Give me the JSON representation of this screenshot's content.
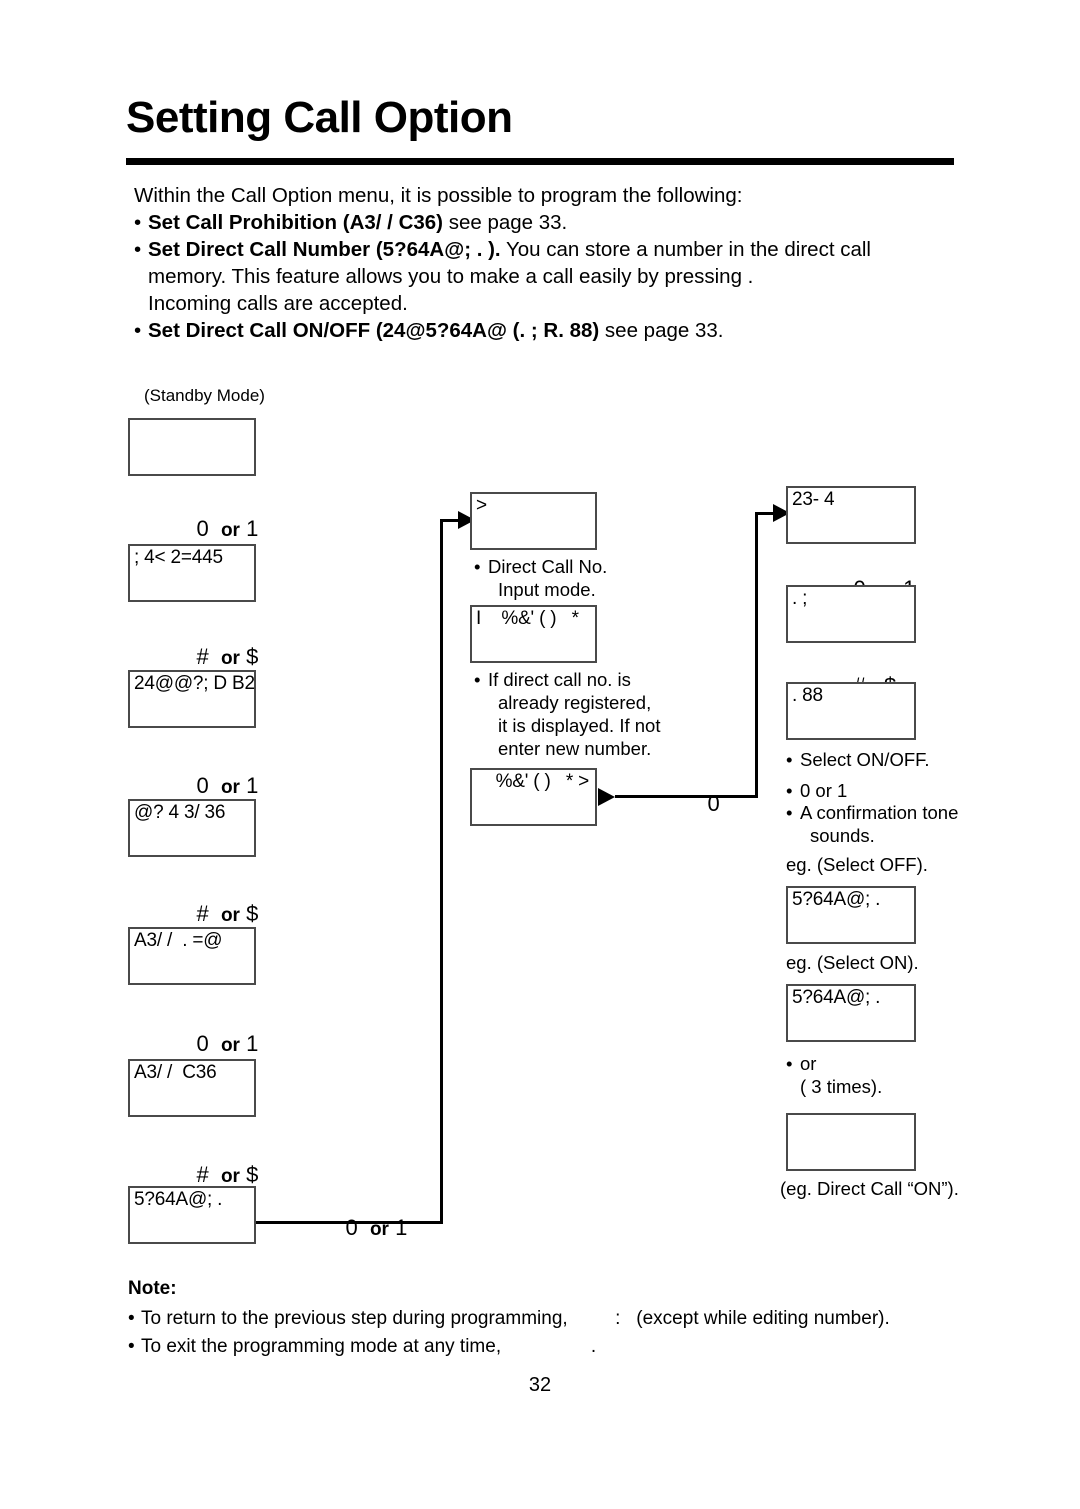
{
  "document": {
    "title": "Setting Call Option",
    "page_number": "32"
  },
  "intro": {
    "lead": "Within the Call Option menu, it is possible to program the following:",
    "bullets": [
      {
        "bold": "Set Call Prohibition (A3/ /  C36)",
        "rest": " see page 33."
      },
      {
        "bold": "Set Direct Call Number (5?64A@; . ).",
        "rest": " You can store a number in the direct call",
        "line2": "memory. This feature allows you to make a call easily by pressing         .",
        "line3": "Incoming calls are accepted."
      },
      {
        "bold": "Set Direct Call ON/OFF (24@5?64A@ (. ; R. 88)",
        "rest": " see page 33."
      }
    ]
  },
  "diagram": {
    "standby_label": "(Standby Mode)",
    "left_column": {
      "screens": [
        {
          "text": ""
        },
        {
          "text": "; 4< 2=445"
        },
        {
          "text": "24@@?; D B2"
        },
        {
          "text": "@? 4 3/ 36"
        },
        {
          "text": "A3/ /  . =@"
        },
        {
          "text": "A3/ /  C36"
        },
        {
          "text": "5?64A@; ."
        }
      ],
      "key_steps": [
        {
          "first": "0",
          "or": "or",
          "second": "1"
        },
        {
          "first": "#",
          "or": "or",
          "second": "$"
        },
        {
          "first": "0",
          "or": "or",
          "second": "1"
        },
        {
          "first": "#",
          "or": "or",
          "second": "$"
        },
        {
          "first": "0",
          "or": "or",
          "second": "1"
        },
        {
          "first": "#",
          "or": "or",
          "second": "$"
        }
      ],
      "exit_key": {
        "first": "0",
        "or": "or",
        "second": "1"
      }
    },
    "middle_column": {
      "screens": [
        {
          "text": ">"
        },
        {
          "text": "I    %&' ( )   *"
        },
        {
          "text": "%&' ( )   * >"
        }
      ],
      "captions": [
        {
          "lines": [
            "Direct Call No.",
            "Input mode."
          ]
        },
        {
          "lines": [
            "If direct call no. is",
            "already registered,",
            "it is displayed. If not",
            "enter new number."
          ]
        }
      ],
      "exit_key": {
        "first": "0"
      }
    },
    "right_column": {
      "screens": [
        {
          "text": "23- 4"
        },
        {
          "text": ". ;"
        },
        {
          "text": ". 88"
        },
        {
          "text": "5?64A@; ."
        },
        {
          "text": "5?64A@; ."
        },
        {
          "text": ""
        }
      ],
      "key_steps": [
        {
          "first": "0",
          "or": "or",
          "second": "1"
        },
        {
          "first": "#",
          "or": "",
          "second": "$"
        }
      ],
      "captions": [
        {
          "text": "Select ON/OFF.",
          "bulleted": true
        },
        {
          "text": "         0   or 1",
          "bulleted": true
        },
        {
          "lines": [
            "A confirmation tone",
            "sounds."
          ],
          "bulleted": true
        }
      ],
      "labels": {
        "eg_off": "eg. (Select OFF).",
        "eg_on": "eg. (Select ON).",
        "or_line": "                 or",
        "times_line": "  (          3 times).",
        "final": "(eg. Direct Call “ON”)."
      }
    }
  },
  "note": {
    "heading": "Note:",
    "lines": [
      "To return to the previous step during programming,         :   (except while editing number).",
      "To exit the programming mode at any time,                 ."
    ]
  }
}
